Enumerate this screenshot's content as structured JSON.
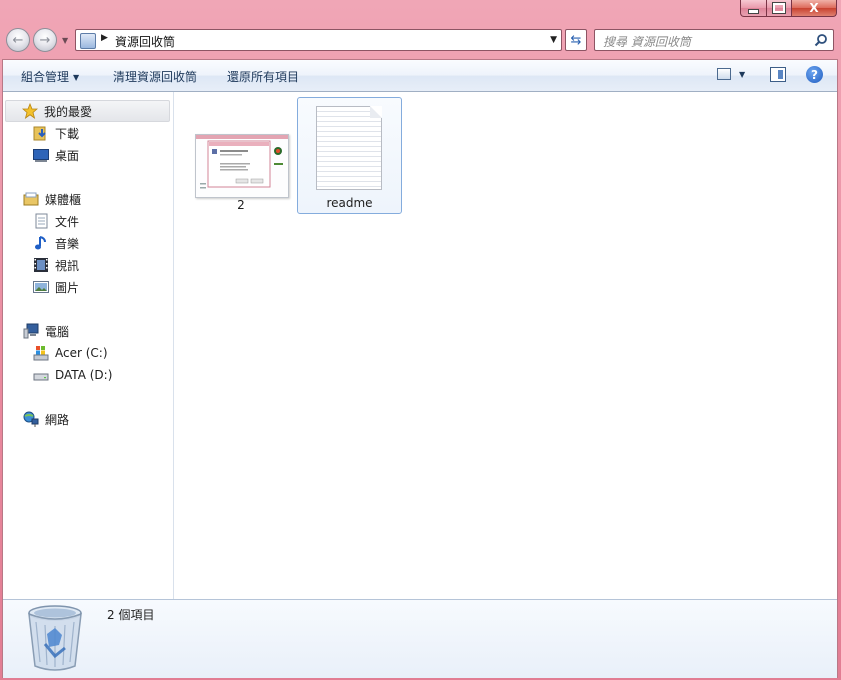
{
  "window": {
    "caption": {
      "minimize": "",
      "maximize": "",
      "close": "X"
    }
  },
  "nav": {
    "address_path": "資源回收筒",
    "search_placeholder": "搜尋 資源回收筒"
  },
  "toolbar": {
    "organize": "組合管理",
    "empty_recycle_bin": "清理資源回收筒",
    "restore_all": "還原所有項目",
    "help": "?"
  },
  "sidebar": {
    "favorites": {
      "label": "我的最愛",
      "items": [
        {
          "label": "下載",
          "icon": "downloads-folder-icon"
        },
        {
          "label": "桌面",
          "icon": "desktop-icon"
        }
      ]
    },
    "libraries": {
      "label": "媒體櫃",
      "items": [
        {
          "label": "文件",
          "icon": "documents-icon"
        },
        {
          "label": "音樂",
          "icon": "music-icon"
        },
        {
          "label": "視訊",
          "icon": "video-icon"
        },
        {
          "label": "圖片",
          "icon": "pictures-icon"
        }
      ]
    },
    "computer": {
      "label": "電腦",
      "items": [
        {
          "label": "Acer (C:)",
          "icon": "windows-drive-icon"
        },
        {
          "label": "DATA (D:)",
          "icon": "drive-icon"
        }
      ]
    },
    "network": {
      "label": "網路"
    }
  },
  "files": [
    {
      "name": "2",
      "type": "image-thumbnail"
    },
    {
      "name": "readme",
      "type": "text-document",
      "selected": true
    }
  ],
  "details": {
    "count": "2 個項目"
  },
  "colors": {
    "frame": "#e9889d",
    "toolbar": "#e7eef8",
    "selection_border": "#84acdd",
    "link_text": "#1e395b"
  }
}
